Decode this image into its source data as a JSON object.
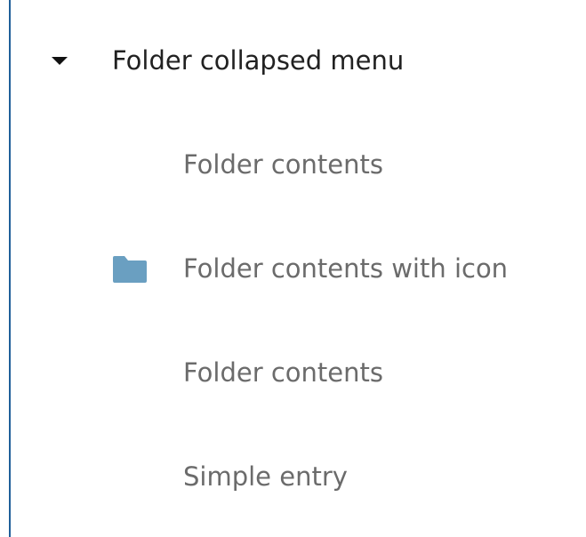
{
  "menu": {
    "folder": {
      "label": "Folder collapsed menu",
      "expanded": true
    },
    "items": [
      {
        "label": "Folder contents",
        "icon": ""
      },
      {
        "label": "Folder contents with icon",
        "icon": "folder-icon"
      },
      {
        "label": "Folder contents",
        "icon": ""
      },
      {
        "label": "Simple entry",
        "icon": ""
      }
    ]
  },
  "colors": {
    "accent_rule": "#1f5f99",
    "folder_icon": "#6a9fc1",
    "folder_text": "#212121",
    "item_text": "#6b6b6b"
  }
}
